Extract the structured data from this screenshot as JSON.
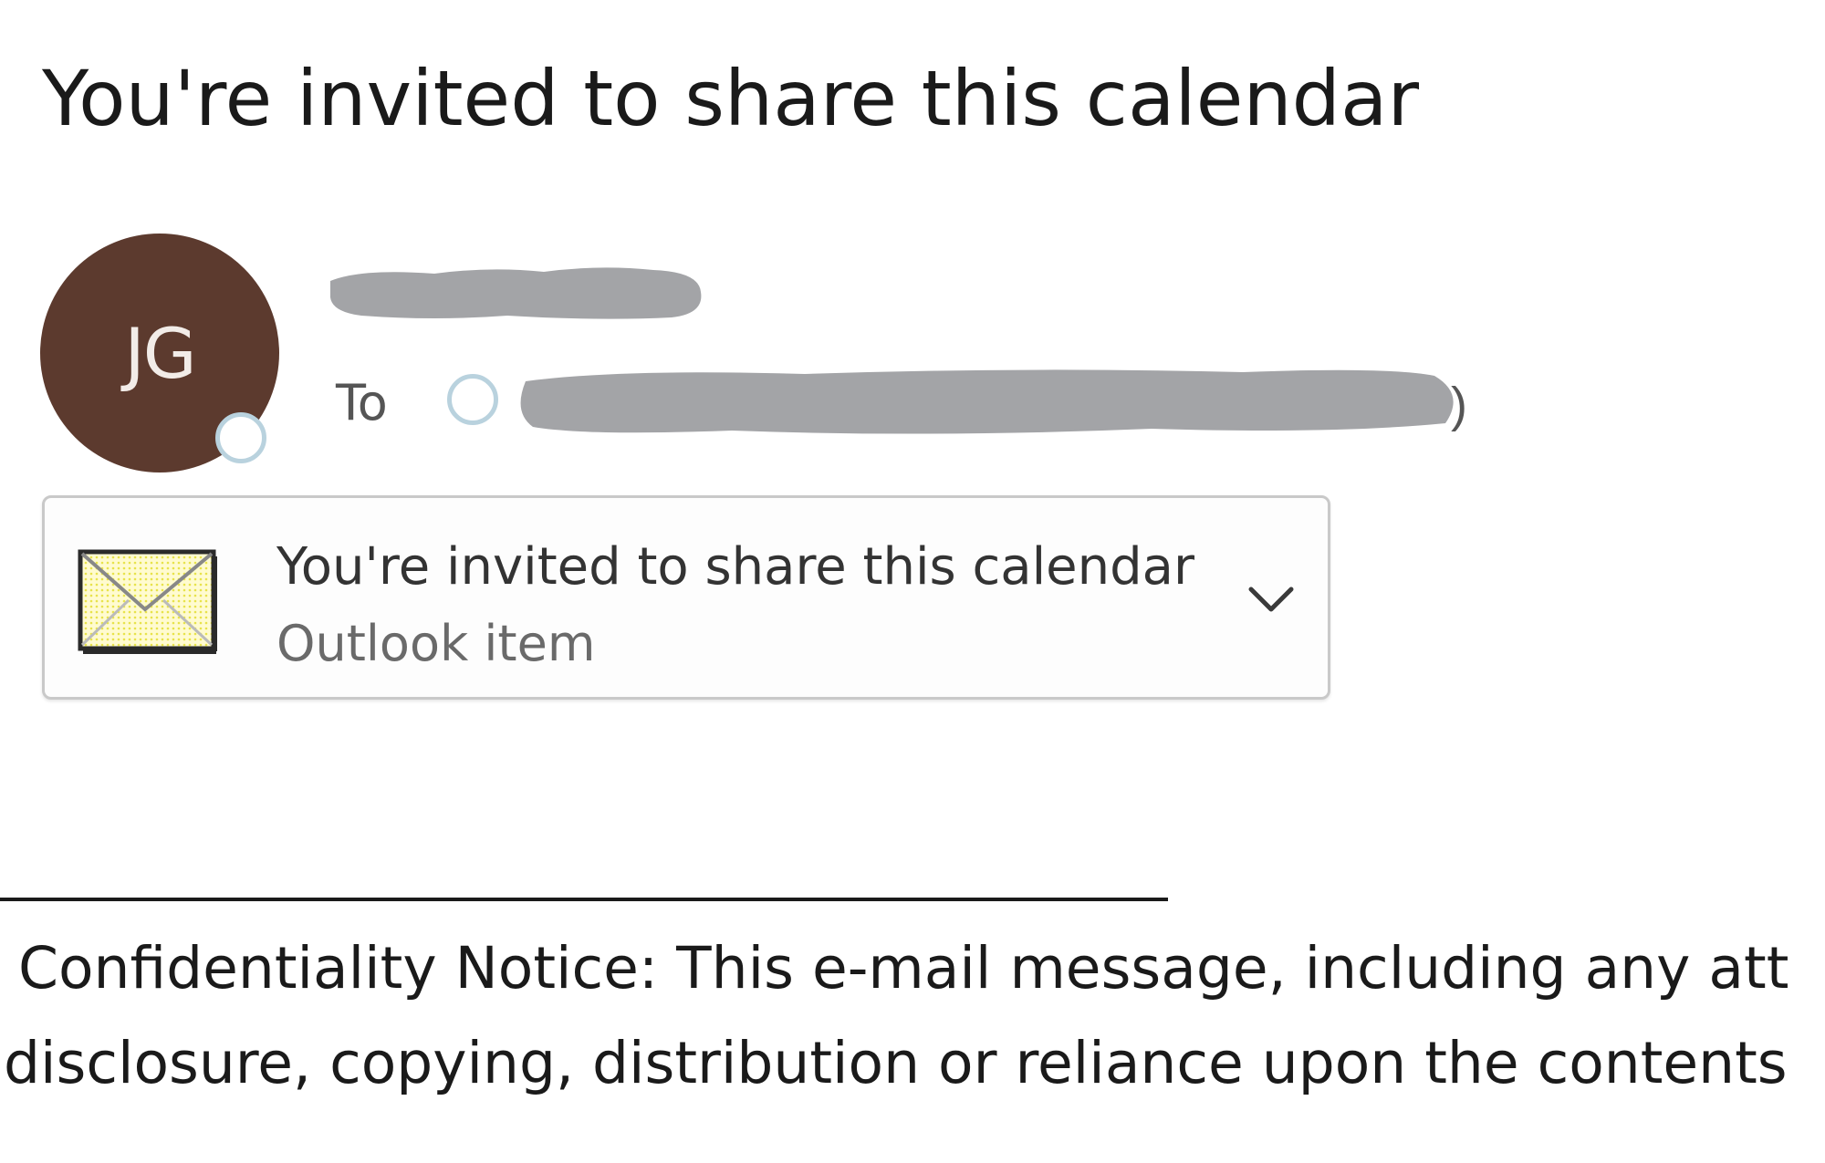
{
  "message": {
    "subject": "You're invited to share this calendar",
    "sender": {
      "initials": "JG",
      "avatar_color": "#5c3a2e",
      "name": "[redacted]"
    },
    "to_label": "To",
    "recipient": "[redacted]"
  },
  "attachment": {
    "icon": "envelope-icon",
    "title": "You're invited to share this calendar",
    "type": "Outlook item",
    "expand_icon": "chevron-down-icon"
  },
  "footer": {
    "notice_line1": "Confidentiality Notice: This e-mail message, including any att",
    "notice_line2": "disclosure, copying, distribution or reliance upon the contents"
  }
}
